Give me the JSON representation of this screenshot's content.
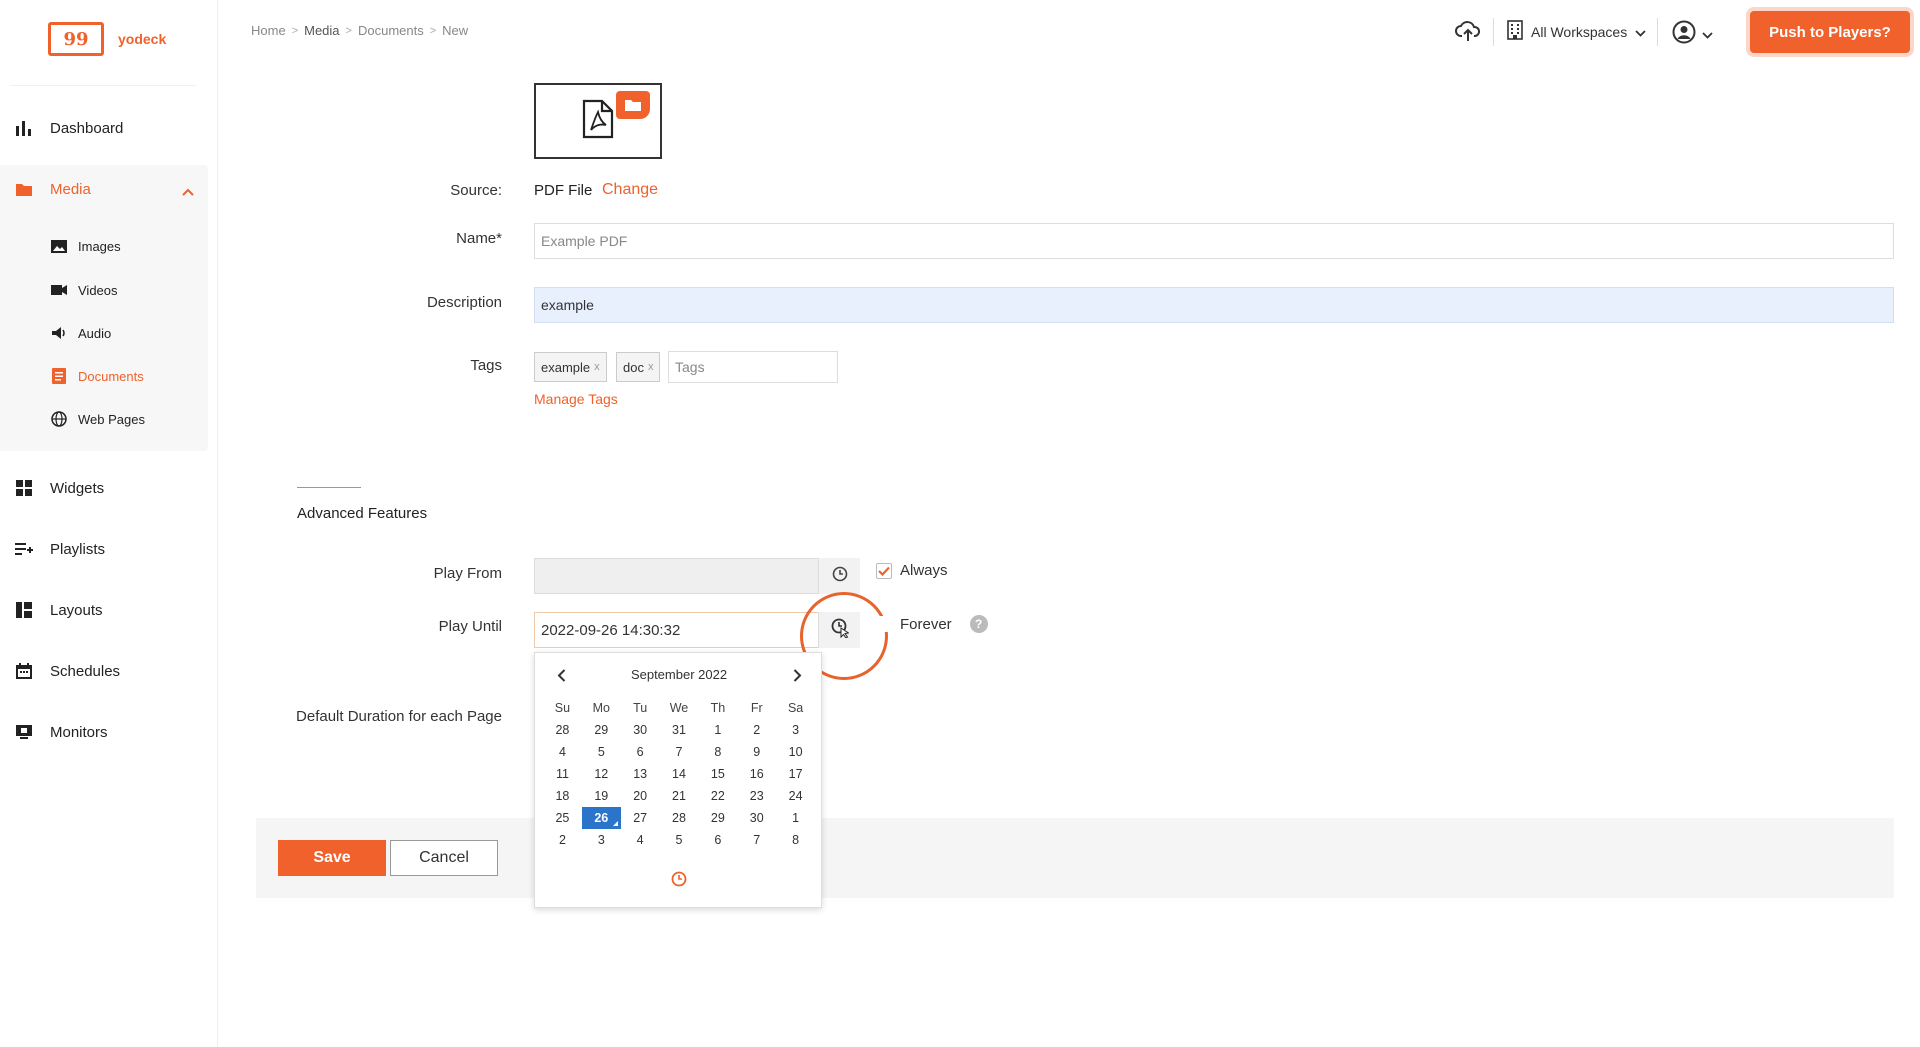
{
  "brand": {
    "name": "yodeck",
    "logo_glyph": "99",
    "accent": "#f0612b"
  },
  "breadcrumb": [
    "Home",
    "Media",
    "Documents",
    "New"
  ],
  "topbar": {
    "workspaces_label": "All Workspaces",
    "push_label": "Push to Players?"
  },
  "sidebar": {
    "items": [
      {
        "label": "Dashboard",
        "icon": "bar-chart-icon"
      },
      {
        "label": "Media",
        "icon": "folder-icon",
        "active": true
      },
      {
        "label": "Widgets",
        "icon": "widgets-icon"
      },
      {
        "label": "Playlists",
        "icon": "playlist-icon"
      },
      {
        "label": "Layouts",
        "icon": "layout-icon"
      },
      {
        "label": "Schedules",
        "icon": "calendar-icon"
      },
      {
        "label": "Monitors",
        "icon": "monitor-icon"
      }
    ],
    "media_sub": [
      {
        "label": "Images",
        "icon": "image-icon"
      },
      {
        "label": "Videos",
        "icon": "video-icon"
      },
      {
        "label": "Audio",
        "icon": "audio-icon"
      },
      {
        "label": "Documents",
        "icon": "document-icon",
        "active": true
      },
      {
        "label": "Web Pages",
        "icon": "globe-icon"
      }
    ]
  },
  "form": {
    "source_label": "Source:",
    "source_value": "PDF File",
    "change_label": "Change",
    "name_label": "Name*",
    "name_placeholder": "Example PDF",
    "description_label": "Description",
    "description_value": "example",
    "tags_label": "Tags",
    "tags": [
      "example",
      "doc"
    ],
    "tag_remove_glyph": "x",
    "tags_placeholder": "Tags",
    "manage_tags_label": "Manage Tags",
    "advanced_title": "Advanced Features",
    "play_from_label": "Play From",
    "play_from_value": "",
    "always_label": "Always",
    "always_checked": true,
    "play_until_label": "Play Until",
    "play_until_value": "2022-09-26 14:30:32",
    "forever_label": "Forever",
    "forever_checked": false,
    "help_glyph": "?",
    "default_duration_label": "Default Duration for each Page"
  },
  "actions": {
    "save_label": "Save",
    "cancel_label": "Cancel"
  },
  "calendar": {
    "title": "September 2022",
    "weekdays": [
      "Su",
      "Mo",
      "Tu",
      "We",
      "Th",
      "Fr",
      "Sa"
    ],
    "weeks": [
      [
        "28",
        "29",
        "30",
        "31",
        "1",
        "2",
        "3"
      ],
      [
        "4",
        "5",
        "6",
        "7",
        "8",
        "9",
        "10"
      ],
      [
        "11",
        "12",
        "13",
        "14",
        "15",
        "16",
        "17"
      ],
      [
        "18",
        "19",
        "20",
        "21",
        "22",
        "23",
        "24"
      ],
      [
        "25",
        "26",
        "27",
        "28",
        "29",
        "30",
        "1"
      ],
      [
        "2",
        "3",
        "4",
        "5",
        "6",
        "7",
        "8"
      ]
    ],
    "selected_day": "26",
    "selected_color": "#2a74c9"
  }
}
